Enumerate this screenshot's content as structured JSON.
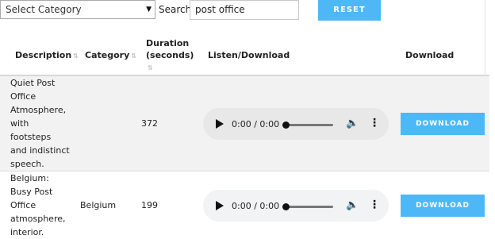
{
  "filters": {
    "category_select_value": "Select Category",
    "search_label": "Search:",
    "search_value": "post office",
    "reset_label": "RESET"
  },
  "table": {
    "headers": {
      "description": "Description",
      "category": "Category",
      "duration_line1": "Duration",
      "duration_line2": "(seconds)",
      "listen": "Listen/Download",
      "download": "Download"
    },
    "rows": [
      {
        "description": "Quiet Post Office Atmosphere, with footsteps and indistinct speech.",
        "category": "",
        "duration": "372",
        "audio_time": "0:00 / 0:00",
        "download_label": "DOWNLOAD"
      },
      {
        "description": "Belgium: Busy Post Office atmosphere, interior.",
        "category": "Belgium",
        "duration": "199",
        "audio_time": "0:00 / 0:00",
        "download_label": "DOWNLOAD"
      }
    ]
  },
  "colors": {
    "accent": "#4db8f5",
    "row_shaded": "#f2f2f2",
    "audio_player": "#f1f3f4"
  },
  "icons": {
    "select_chevron": "chevron-down-icon",
    "sort": "sort-icon",
    "play": "play-icon",
    "volume": "volume-icon",
    "more": "more-options-icon"
  }
}
